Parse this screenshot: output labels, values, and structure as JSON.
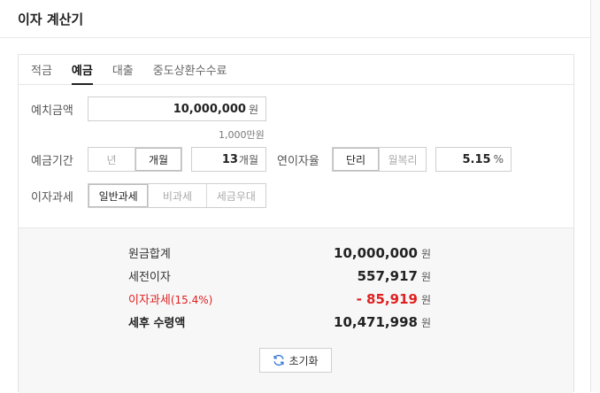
{
  "header": {
    "title": "이자 계산기"
  },
  "tabs": [
    {
      "label": "적금"
    },
    {
      "label": "예금"
    },
    {
      "label": "대출"
    },
    {
      "label": "중도상환수수료"
    }
  ],
  "deposit": {
    "label": "예치금액",
    "value": "10,000,000",
    "unit": "원",
    "hint": "1,000만원"
  },
  "period": {
    "label": "예금기간",
    "options": [
      "년",
      "개월"
    ],
    "value": "13",
    "unit": "개월"
  },
  "rate": {
    "label": "연이자율",
    "options": [
      "단리",
      "월복리"
    ],
    "value": "5.15",
    "unit": "%"
  },
  "tax": {
    "label": "이자과세",
    "options": [
      "일반과세",
      "비과세",
      "세금우대"
    ]
  },
  "results": {
    "principal": {
      "label": "원금합계",
      "value": "10,000,000",
      "unit": "원"
    },
    "pretax": {
      "label": "세전이자",
      "value": "557,917",
      "unit": "원"
    },
    "taxamt": {
      "label": "이자과세",
      "rate": "(15.4%)",
      "value": "- 85,919",
      "unit": "원"
    },
    "net": {
      "label": "세후 수령액",
      "value": "10,471,998",
      "unit": "원"
    }
  },
  "reset_label": "초기화",
  "colors": {
    "accent_red": "#e02020",
    "result_bg": "#f7f7f7"
  }
}
